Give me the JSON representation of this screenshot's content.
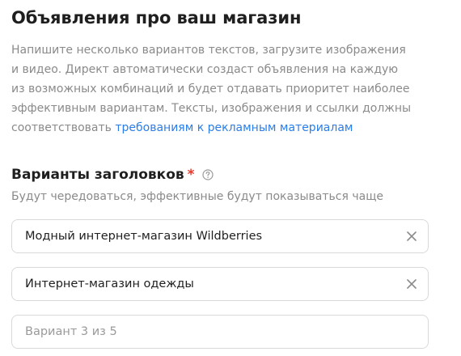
{
  "section": {
    "title": "Объявления про ваш магазин",
    "description_lines": [
      "Напишите несколько вариантов текстов, загрузите изображения",
      "и видео. Директ автоматически создаст объявления на каждую",
      "из возможных комбинаций и будет отдавать приоритет наиболее",
      "эффективным вариантам. Тексты, изображения и ссылки должны"
    ],
    "description_last_prefix": "соответствовать ",
    "requirements_link": "требованиям к рекламным материалам"
  },
  "headlines": {
    "title": "Варианты заголовков",
    "required_mark": "*",
    "help_icon": "question-circle-icon",
    "hint": "Будут чередоваться, эффективные будут показываться чаще",
    "inputs": [
      {
        "value": "Модный интернет-магазин Wildberries",
        "placeholder": ""
      },
      {
        "value": "Интернет-магазин одежды",
        "placeholder": ""
      },
      {
        "value": "",
        "placeholder": "Вариант 3 из 5"
      }
    ],
    "clear_icon": "close-icon"
  },
  "colors": {
    "text": "#1f1f1f",
    "muted": "#8a8a8a",
    "link": "#2b7de9",
    "required": "#e8372c",
    "border": "#d9d9d9"
  }
}
